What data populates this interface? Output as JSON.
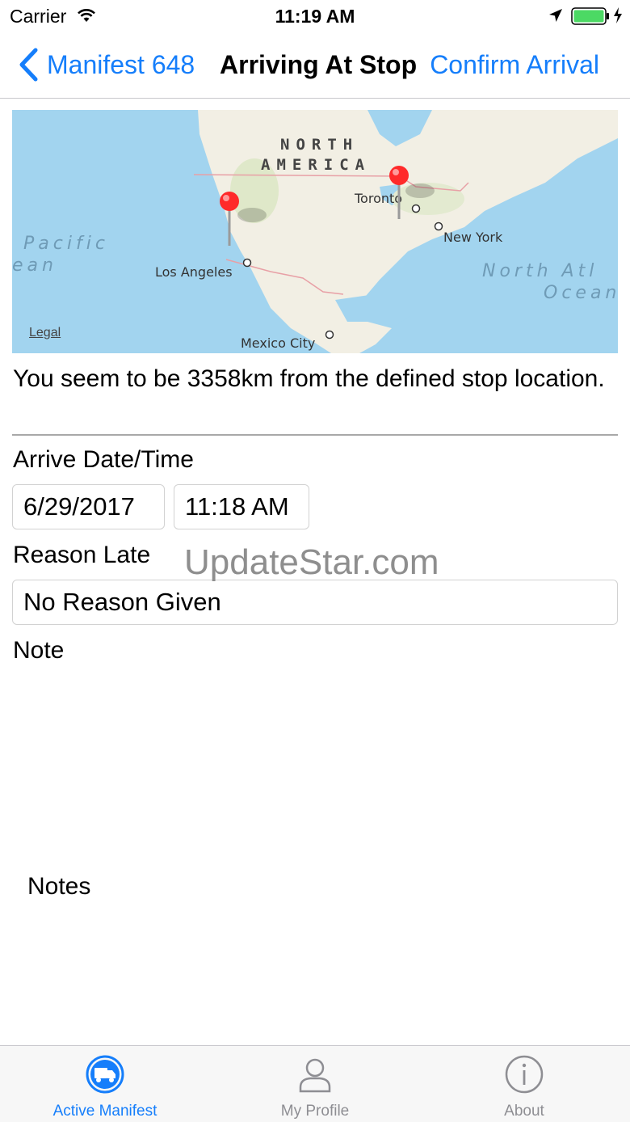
{
  "status_bar": {
    "carrier": "Carrier",
    "time": "11:19 AM",
    "battery_color": "#4cd964"
  },
  "nav": {
    "back_label": "Manifest 648",
    "title": "Arriving At Stop",
    "action_label": "Confirm Arrival",
    "accent_color": "#157efb"
  },
  "map": {
    "labels": {
      "north_america_1": "NORTH",
      "north_america_2": "AMERICA",
      "pacific_1": "Pacific",
      "pacific_2": "ean",
      "atlantic_1": "North Atl",
      "atlantic_2": "Ocean",
      "toronto": "Toronto",
      "new_york": "New York",
      "los_angeles": "Los Angeles",
      "mexico_city": "Mexico City"
    },
    "legal_link": "Legal",
    "pins": [
      "current-location-pin",
      "stop-location-pin"
    ]
  },
  "distance_message": "You seem to be 3358km from the defined stop location.",
  "arrive": {
    "label": "Arrive Date/Time",
    "date": "6/29/2017",
    "time": "11:18 AM"
  },
  "reason_late": {
    "label": "Reason Late",
    "value": "No Reason Given"
  },
  "note": {
    "label": "Note",
    "placeholder": "Notes"
  },
  "watermark": "UpdateStar.com",
  "tab_bar": {
    "tabs": [
      {
        "label": "Active Manifest",
        "icon": "truck-icon",
        "active": true
      },
      {
        "label": "My Profile",
        "icon": "person-icon",
        "active": false
      },
      {
        "label": "About",
        "icon": "info-icon",
        "active": false
      }
    ]
  }
}
